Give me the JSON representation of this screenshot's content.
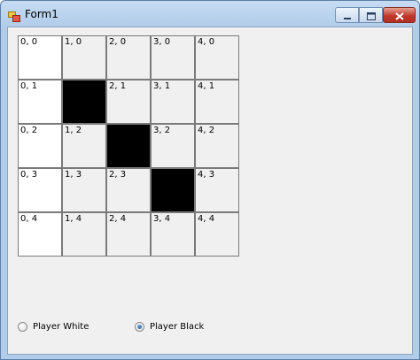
{
  "window": {
    "title": "Form1"
  },
  "board": {
    "cells": [
      [
        {
          "label": "0, 0",
          "color": "white"
        },
        {
          "label": "1, 0",
          "color": "gray"
        },
        {
          "label": "2, 0",
          "color": "gray"
        },
        {
          "label": "3, 0",
          "color": "gray"
        },
        {
          "label": "4, 0",
          "color": "gray"
        }
      ],
      [
        {
          "label": "0, 1",
          "color": "white"
        },
        {
          "label": "1, 1",
          "color": "black"
        },
        {
          "label": "2, 1",
          "color": "gray"
        },
        {
          "label": "3, 1",
          "color": "gray"
        },
        {
          "label": "4, 1",
          "color": "gray"
        }
      ],
      [
        {
          "label": "0, 2",
          "color": "white"
        },
        {
          "label": "1, 2",
          "color": "gray"
        },
        {
          "label": "2, 2",
          "color": "black"
        },
        {
          "label": "3, 2",
          "color": "gray"
        },
        {
          "label": "4, 2",
          "color": "gray"
        }
      ],
      [
        {
          "label": "0, 3",
          "color": "white"
        },
        {
          "label": "1, 3",
          "color": "gray"
        },
        {
          "label": "2, 3",
          "color": "gray"
        },
        {
          "label": "3, 3",
          "color": "black"
        },
        {
          "label": "4, 3",
          "color": "gray"
        }
      ],
      [
        {
          "label": "0, 4",
          "color": "white"
        },
        {
          "label": "1, 4",
          "color": "gray"
        },
        {
          "label": "2, 4",
          "color": "gray"
        },
        {
          "label": "3, 4",
          "color": "gray"
        },
        {
          "label": "4, 4",
          "color": "gray"
        }
      ]
    ]
  },
  "players": {
    "white": {
      "label": "Player White",
      "checked": false
    },
    "black": {
      "label": "Player Black",
      "checked": true
    }
  },
  "icons": {
    "app": "app-icon",
    "minimize": "minimize-icon",
    "maximize": "maximize-icon",
    "close": "close-icon"
  }
}
